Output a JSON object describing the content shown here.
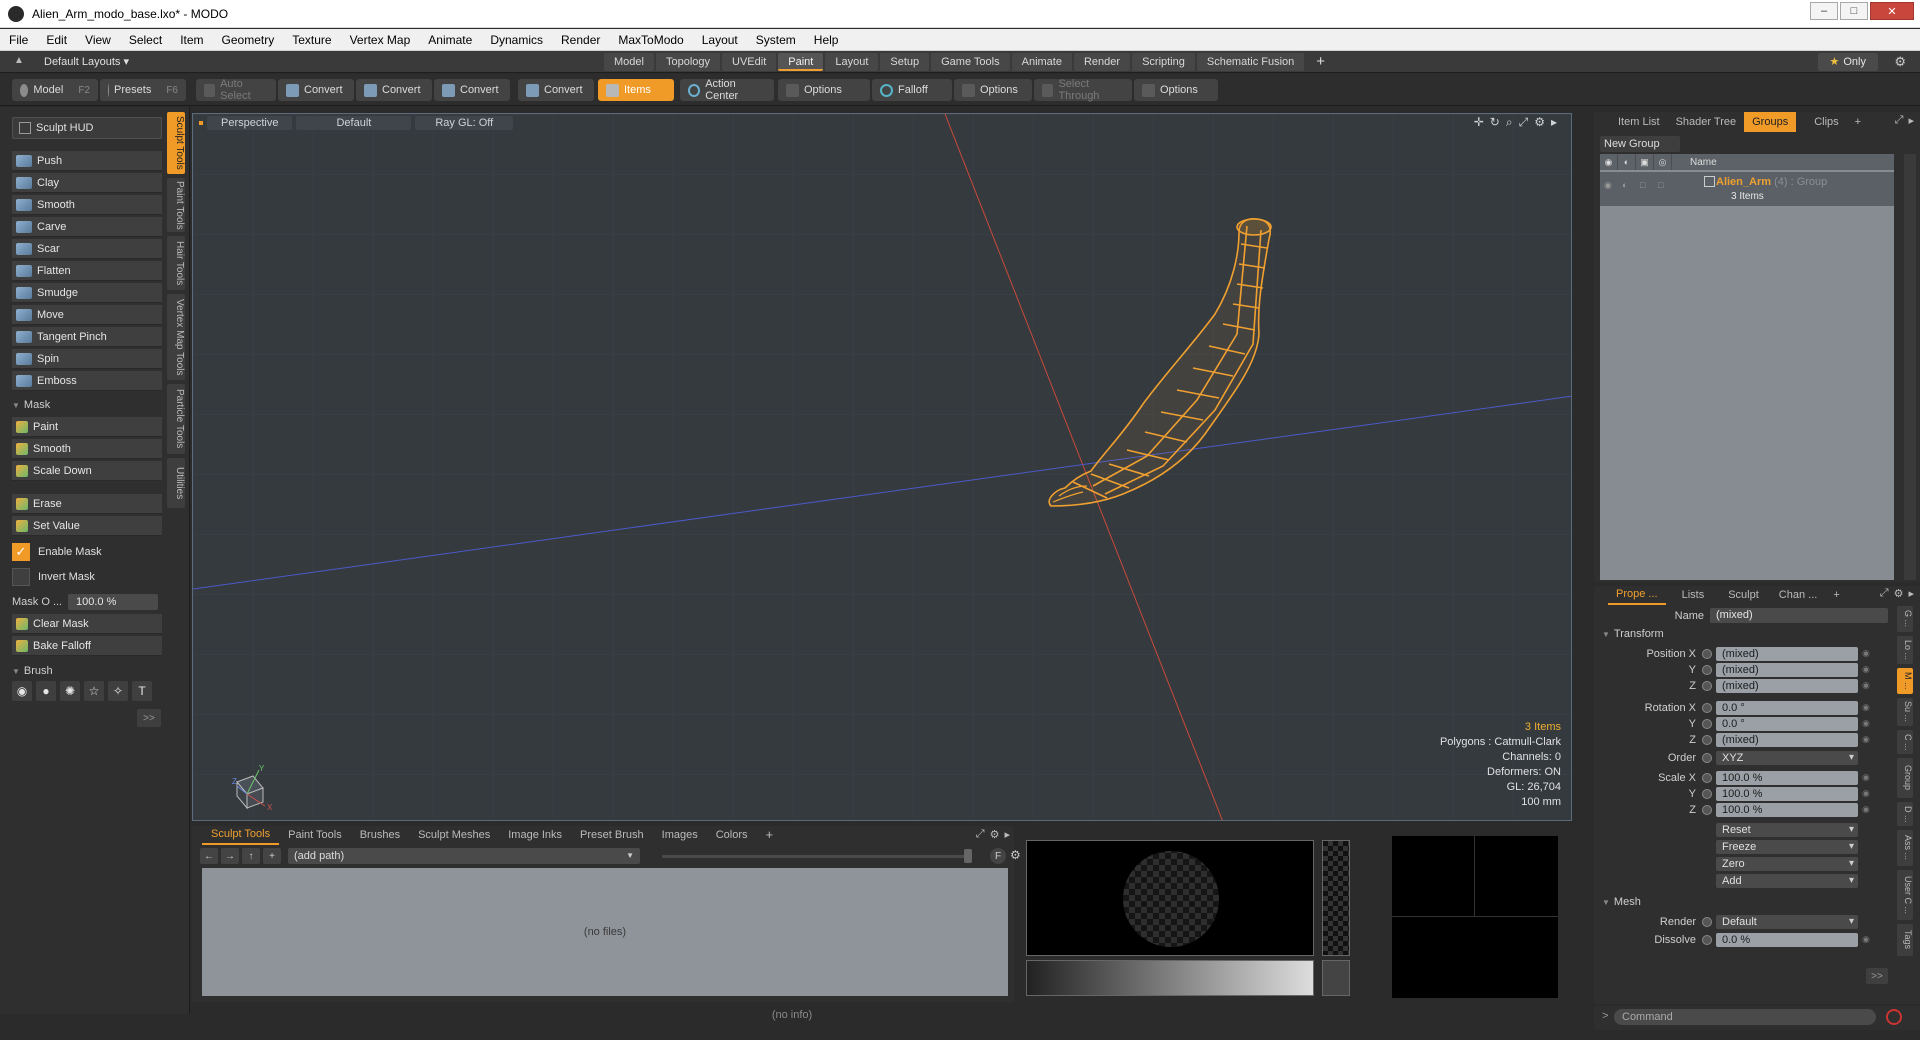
{
  "window": {
    "title": "Alien_Arm_modo_base.lxo* - MODO"
  },
  "menu": [
    "File",
    "Edit",
    "View",
    "Select",
    "Item",
    "Geometry",
    "Texture",
    "Vertex Map",
    "Animate",
    "Dynamics",
    "Render",
    "MaxToModo",
    "Layout",
    "System",
    "Help"
  ],
  "layout_bar": {
    "layout_dropdown": "Default Layouts ▾",
    "tabs": [
      "Model",
      "Topology",
      "UVEdit",
      "Paint",
      "Layout",
      "Setup",
      "Game Tools",
      "Animate",
      "Render",
      "Scripting",
      "Schematic Fusion"
    ],
    "active_tab": "Paint",
    "plus": "+",
    "only_label": "Only",
    "star": "★"
  },
  "toolbar": {
    "model_label": "Model",
    "model_key": "F2",
    "presets_label": "Presets",
    "presets_key": "F6",
    "auto_select": "Auto Select",
    "convert1": "Convert",
    "convert2": "Convert",
    "convert3": "Convert",
    "convert4": "Convert",
    "items": "Items",
    "action_center": "Action Center",
    "options1": "Options",
    "falloff": "Falloff",
    "options2": "Options",
    "select_through": "Select Through",
    "options3": "Options"
  },
  "left_panel": {
    "side_tabs": [
      "Sculpt Tools",
      "Paint Tools",
      "Hair Tools",
      "Vertex Map Tools",
      "Particle Tools",
      "Utilities"
    ],
    "hud": "Sculpt HUD",
    "tools": [
      "Push",
      "Clay",
      "Smooth",
      "Carve",
      "Scar",
      "Flatten",
      "Smudge",
      "Move",
      "Tangent Pinch",
      "Spin",
      "Emboss"
    ],
    "mask_section": "Mask",
    "mask_tools": [
      "Paint",
      "Smooth",
      "Scale Down"
    ],
    "mask_tools2": [
      "Erase",
      "Set Value"
    ],
    "enable_mask": "Enable Mask",
    "invert_mask": "Invert Mask",
    "mask_opacity_label": "Mask O ...",
    "mask_opacity_value": "100.0 %",
    "clear_mask": "Clear Mask",
    "bake_falloff": "Bake Falloff",
    "brush_section": "Brush",
    "expand": ">>"
  },
  "viewport": {
    "perspective": "Perspective",
    "default": "Default",
    "raygl": "Ray GL: Off",
    "info": {
      "items": "3 Items",
      "polygons": "Polygons : Catmull-Clark",
      "channels": "Channels: 0",
      "deformers": "Deformers: ON",
      "gl": "GL: 26,704",
      "scale": "100 mm"
    },
    "axis_labels": {
      "y": "Y",
      "z": "Z",
      "x": "X"
    }
  },
  "browser": {
    "tabs": [
      "Sculpt Tools",
      "Paint Tools",
      "Brushes",
      "Sculpt Meshes",
      "Image Inks",
      "Preset Brush",
      "Images",
      "Colors"
    ],
    "active_tab": "Sculpt Tools",
    "plus": "+",
    "path": "(add path)",
    "no_files": "(no files)",
    "f_button": "F"
  },
  "status": {
    "no_info": "(no info)"
  },
  "right_top": {
    "tabs": [
      "Item List",
      "Shader Tree",
      "Groups",
      "Clips"
    ],
    "active_tab": "Groups",
    "plus": "+",
    "new_group": "New Group",
    "name_header": "Name",
    "group_name": "Alien_Arm",
    "group_tag": "(4) : Group",
    "group_sub": "3 Items"
  },
  "properties": {
    "tabs": [
      "Prope ...",
      "Lists",
      "Sculpt",
      "Chan ..."
    ],
    "active_tab": "Prope ...",
    "plus": "+",
    "name_label": "Name",
    "name_value": "(mixed)",
    "transform_section": "Transform",
    "position": [
      {
        "label": "Position X",
        "value": "(mixed)"
      },
      {
        "label": "Y",
        "value": "(mixed)"
      },
      {
        "label": "Z",
        "value": "(mixed)"
      }
    ],
    "rotation": [
      {
        "label": "Rotation X",
        "value": "0.0 °"
      },
      {
        "label": "Y",
        "value": "0.0 °"
      },
      {
        "label": "Z",
        "value": "(mixed)"
      }
    ],
    "order_label": "Order",
    "order_value": "XYZ",
    "scale": [
      {
        "label": "Scale X",
        "value": "100.0 %"
      },
      {
        "label": "Y",
        "value": "100.0 %"
      },
      {
        "label": "Z",
        "value": "100.0 %"
      }
    ],
    "actions": [
      "Reset",
      "Freeze",
      "Zero",
      "Add"
    ],
    "mesh_section": "Mesh",
    "render_label": "Render",
    "render_value": "Default",
    "dissolve_label": "Dissolve",
    "dissolve_value": "0.0 %",
    "side_tabs": [
      "G ...",
      "Lo ...",
      "M ...",
      "Su ...",
      "C ...",
      "Group",
      "D ...",
      "Ass ...",
      "User C ...",
      "Tags"
    ],
    "expand": ">>"
  },
  "command": {
    "placeholder": "Command",
    "prompt": ">"
  },
  "colors": {
    "accent": "#f09a28",
    "mesh": "#f0a030"
  }
}
